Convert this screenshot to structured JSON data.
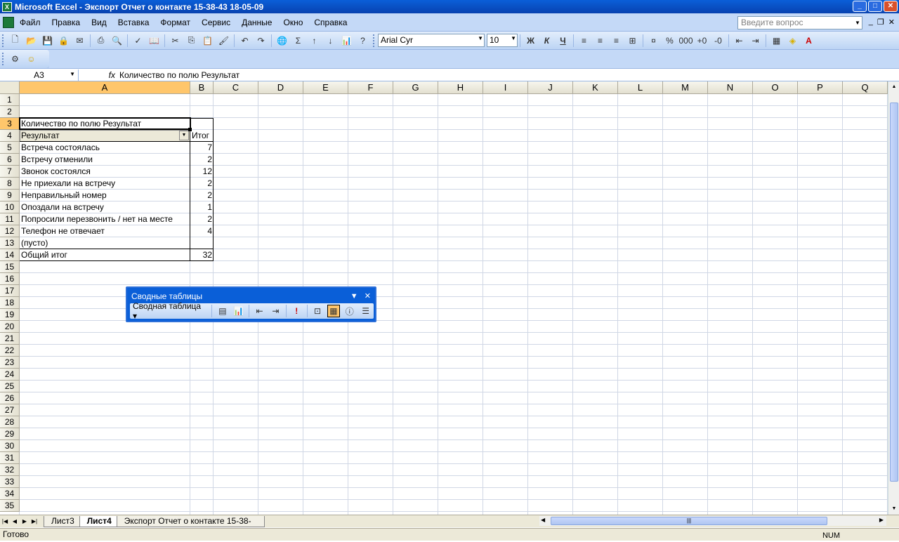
{
  "window": {
    "title": "Microsoft Excel - Экспорт Отчет о контакте 15-38-43 18-05-09"
  },
  "menu": {
    "items": [
      "Файл",
      "Правка",
      "Вид",
      "Вставка",
      "Формат",
      "Сервис",
      "Данные",
      "Окно",
      "Справка"
    ],
    "help_placeholder": "Введите вопрос"
  },
  "format": {
    "font": "Arial Cyr",
    "size": "10",
    "percent": "%"
  },
  "formula": {
    "cell_ref": "A3",
    "fx": "fx",
    "content": "Количество по полю Результат"
  },
  "columns": [
    "A",
    "B",
    "C",
    "D",
    "E",
    "F",
    "G",
    "H",
    "I",
    "J",
    "K",
    "L",
    "M",
    "N",
    "O",
    "P",
    "Q"
  ],
  "rows": [
    "1",
    "2",
    "3",
    "4",
    "5",
    "6",
    "7",
    "8",
    "9",
    "10",
    "11",
    "12",
    "13",
    "14",
    "15",
    "16",
    "17",
    "18",
    "19",
    "20",
    "21",
    "22",
    "23",
    "24",
    "25",
    "26",
    "27",
    "28",
    "29",
    "30",
    "31",
    "32",
    "33",
    "34",
    "35"
  ],
  "pivot_table": {
    "header": "Количество по полю Результат",
    "field_label": "Результат",
    "total_label": "Итог",
    "rows": [
      {
        "label": "Встреча состоялась",
        "value": "7"
      },
      {
        "label": "Встречу отменили",
        "value": "2"
      },
      {
        "label": "Звонок состоялся",
        "value": "12"
      },
      {
        "label": "Не приехали на встречу",
        "value": "2"
      },
      {
        "label": "Неправильный номер",
        "value": "2"
      },
      {
        "label": "Опоздали на встречу",
        "value": "1"
      },
      {
        "label": "Попросили перезвонить / нет на месте",
        "value": "2"
      },
      {
        "label": "Телефон не отвечает",
        "value": "4"
      },
      {
        "label": "(пусто)",
        "value": ""
      }
    ],
    "grand_total_label": "Общий итог",
    "grand_total_value": "32"
  },
  "pivot_toolbar": {
    "title": "Сводные таблицы",
    "menu_label": "Сводная таблица"
  },
  "sheets": {
    "tabs": [
      "Лист3",
      "Лист4",
      "Экспорт Отчет о контакте 15-38-"
    ],
    "active": "Лист4"
  },
  "status": {
    "left": "Готово",
    "num": "NUM"
  },
  "accent": {
    "title_blue": "#0a5fd8",
    "selection_orange": "#ffc66b"
  }
}
